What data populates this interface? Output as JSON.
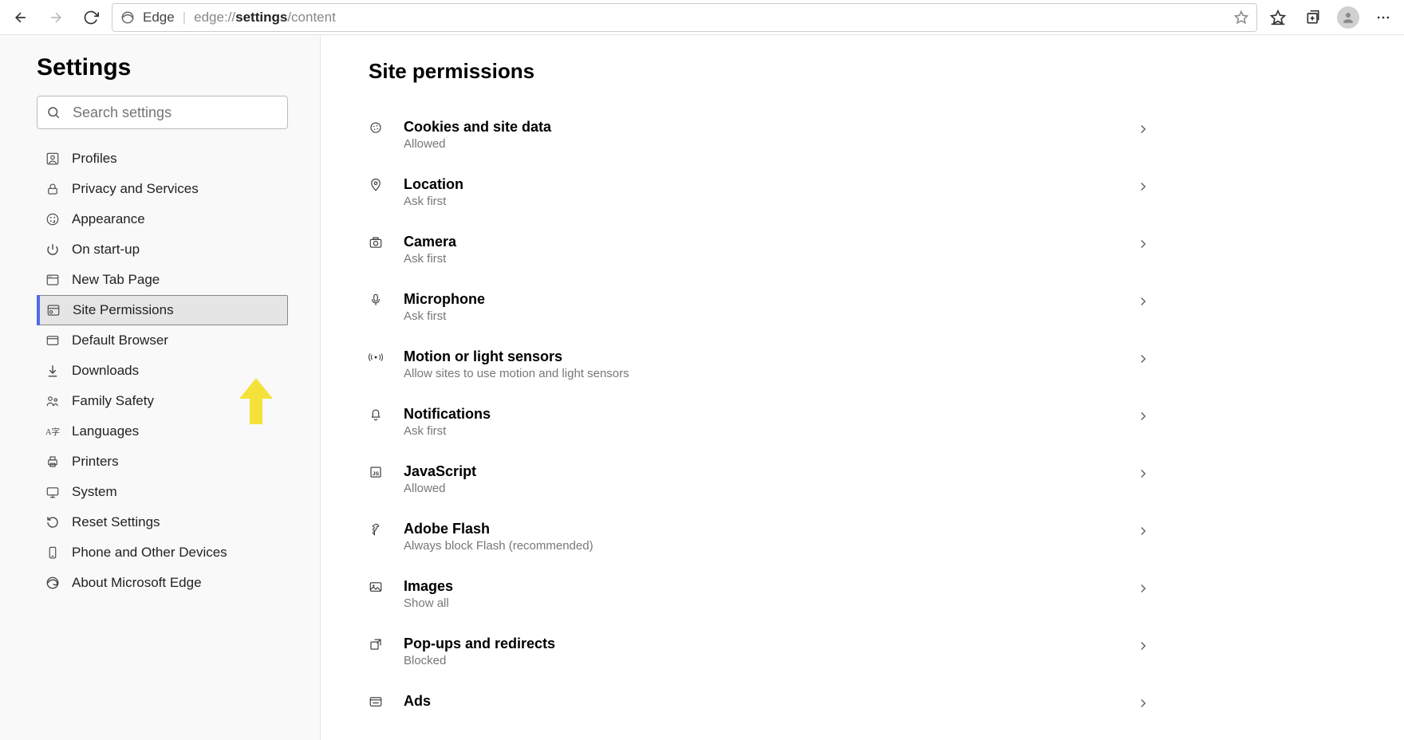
{
  "toolbar": {
    "brand": "Edge",
    "url_prefix": "edge://",
    "url_bold": "settings",
    "url_suffix": "/content"
  },
  "sidebar": {
    "title": "Settings",
    "search_placeholder": "Search settings",
    "items": [
      {
        "id": "profiles",
        "label": "Profiles",
        "icon": "profiles-icon",
        "selected": false
      },
      {
        "id": "privacy",
        "label": "Privacy and Services",
        "icon": "lock-icon",
        "selected": false
      },
      {
        "id": "appearance",
        "label": "Appearance",
        "icon": "palette-icon",
        "selected": false
      },
      {
        "id": "startup",
        "label": "On start-up",
        "icon": "power-icon",
        "selected": false
      },
      {
        "id": "newtab",
        "label": "New Tab Page",
        "icon": "grid-icon",
        "selected": false
      },
      {
        "id": "siteperm",
        "label": "Site Permissions",
        "icon": "siteperm-icon",
        "selected": true
      },
      {
        "id": "defaultbrowser",
        "label": "Default Browser",
        "icon": "window-icon",
        "selected": false
      },
      {
        "id": "downloads",
        "label": "Downloads",
        "icon": "download-icon",
        "selected": false
      },
      {
        "id": "family",
        "label": "Family Safety",
        "icon": "family-icon",
        "selected": false
      },
      {
        "id": "languages",
        "label": "Languages",
        "icon": "languages-icon",
        "selected": false
      },
      {
        "id": "printers",
        "label": "Printers",
        "icon": "printer-icon",
        "selected": false
      },
      {
        "id": "system",
        "label": "System",
        "icon": "system-icon",
        "selected": false
      },
      {
        "id": "reset",
        "label": "Reset Settings",
        "icon": "reset-icon",
        "selected": false
      },
      {
        "id": "phone",
        "label": "Phone and Other Devices",
        "icon": "phone-icon",
        "selected": false
      },
      {
        "id": "about",
        "label": "About Microsoft Edge",
        "icon": "edge-icon",
        "selected": false
      }
    ]
  },
  "content": {
    "heading": "Site permissions",
    "items": [
      {
        "id": "cookies",
        "title": "Cookies and site data",
        "sub": "Allowed",
        "icon": "cookie-icon"
      },
      {
        "id": "location",
        "title": "Location",
        "sub": "Ask first",
        "icon": "location-icon"
      },
      {
        "id": "camera",
        "title": "Camera",
        "sub": "Ask first",
        "icon": "camera-icon"
      },
      {
        "id": "microphone",
        "title": "Microphone",
        "sub": "Ask first",
        "icon": "mic-icon"
      },
      {
        "id": "motion",
        "title": "Motion or light sensors",
        "sub": "Allow sites to use motion and light sensors",
        "icon": "sensor-icon"
      },
      {
        "id": "notifications",
        "title": "Notifications",
        "sub": "Ask first",
        "icon": "bell-icon"
      },
      {
        "id": "javascript",
        "title": "JavaScript",
        "sub": "Allowed",
        "icon": "js-icon"
      },
      {
        "id": "flash",
        "title": "Adobe Flash",
        "sub": "Always block Flash (recommended)",
        "icon": "flash-icon"
      },
      {
        "id": "images",
        "title": "Images",
        "sub": "Show all",
        "icon": "image-icon"
      },
      {
        "id": "popups",
        "title": "Pop-ups and redirects",
        "sub": "Blocked",
        "icon": "popup-icon"
      },
      {
        "id": "ads",
        "title": "Ads",
        "sub": "",
        "icon": "ads-icon"
      }
    ]
  }
}
